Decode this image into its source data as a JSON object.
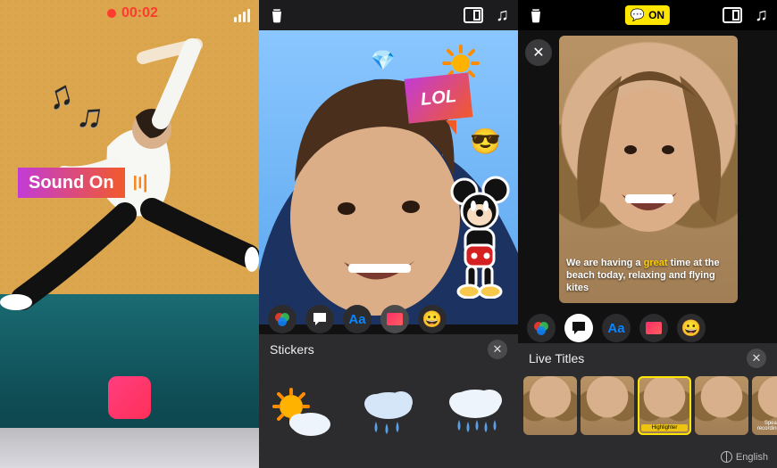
{
  "recording": {
    "time_label": "00:02"
  },
  "panel1": {
    "sticker_text": "Sound On",
    "sticker_waves": "ⳇ)))"
  },
  "panel2": {
    "drawer_title": "Stickers",
    "overlays": {
      "lol_text": "LOL"
    },
    "toolbar": {
      "filters": "filters",
      "speech": "speech",
      "text": "Aa",
      "stickers": "stickers",
      "emoji": "emoji"
    }
  },
  "panel3": {
    "badge_label": "ON",
    "caption_pre": "We are having a ",
    "caption_hl": "great",
    "caption_post": " time at the beach today, relaxing and flying kites",
    "drawer_title": "Live Titles",
    "selected_style": "Highlighter",
    "language_label": "English",
    "thumb_spoken_label": "Speak while recording appears"
  }
}
